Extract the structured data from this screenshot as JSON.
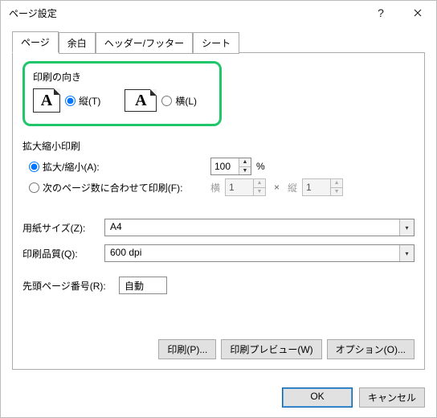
{
  "window": {
    "title": "ページ設定"
  },
  "tabs": [
    "ページ",
    "余白",
    "ヘッダー/フッター",
    "シート"
  ],
  "orientation": {
    "group_label": "印刷の向き",
    "portrait_label": "縦(T)",
    "landscape_label": "横(L)",
    "selected": "portrait",
    "glyph": "A"
  },
  "scaling": {
    "group_label": "拡大縮小印刷",
    "adjust_label": "拡大/縮小(A):",
    "adjust_value": "100",
    "adjust_suffix": "%",
    "fit_label": "次のページ数に合わせて印刷(F):",
    "fit_wide_label": "横",
    "fit_wide_value": "1",
    "fit_times": "×",
    "fit_tall_label": "縦",
    "fit_tall_value": "1",
    "selected": "adjust"
  },
  "paper_size": {
    "label": "用紙サイズ(Z):",
    "value": "A4"
  },
  "print_quality": {
    "label": "印刷品質(Q):",
    "value": "600 dpi"
  },
  "first_page": {
    "label": "先頭ページ番号(R):",
    "value": "自動"
  },
  "panel_buttons": {
    "print": "印刷(P)...",
    "preview": "印刷プレビュー(W)",
    "options": "オプション(O)..."
  },
  "footer": {
    "ok": "OK",
    "cancel": "キャンセル"
  }
}
